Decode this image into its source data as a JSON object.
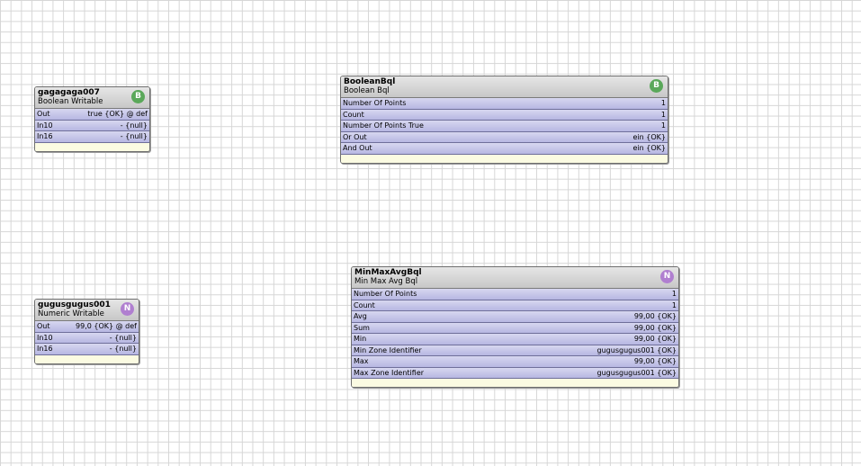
{
  "components": [
    {
      "title": "gagagaga007",
      "type": "Boolean Writable",
      "badge": "B",
      "rows": [
        {
          "label": "Out",
          "value": "true {OK} @ def"
        },
        {
          "label": "In10",
          "value": "- {null}"
        },
        {
          "label": "In16",
          "value": "- {null}"
        }
      ]
    },
    {
      "title": "BooleanBql",
      "type": "Boolean Bql",
      "badge": "B",
      "rows": [
        {
          "label": "Number Of Points",
          "value": "1"
        },
        {
          "label": "Count",
          "value": "1"
        },
        {
          "label": "Number Of Points True",
          "value": "1"
        },
        {
          "label": "Or Out",
          "value": "ein {OK}"
        },
        {
          "label": "And Out",
          "value": "ein {OK}"
        }
      ]
    },
    {
      "title": "gugusgugus001",
      "type": "Numeric Writable",
      "badge": "N",
      "rows": [
        {
          "label": "Out",
          "value": "99,0 {OK} @ def"
        },
        {
          "label": "In10",
          "value": "- {null}"
        },
        {
          "label": "In16",
          "value": "- {null}"
        }
      ]
    },
    {
      "title": "MinMaxAvgBql",
      "type": "Min Max Avg Bql",
      "badge": "N",
      "rows": [
        {
          "label": "Number Of Points",
          "value": "1"
        },
        {
          "label": "Count",
          "value": "1"
        },
        {
          "label": "Avg",
          "value": "99,00 {OK}"
        },
        {
          "label": "Sum",
          "value": "99,00 {OK}"
        },
        {
          "label": "Min",
          "value": "99,00 {OK}"
        },
        {
          "label": "Min Zone Identifier",
          "value": "gugusgugus001 {OK}"
        },
        {
          "label": "Max",
          "value": "99,00 {OK}"
        },
        {
          "label": "Max Zone Identifier",
          "value": "gugusgugus001 {OK}"
        }
      ]
    }
  ]
}
